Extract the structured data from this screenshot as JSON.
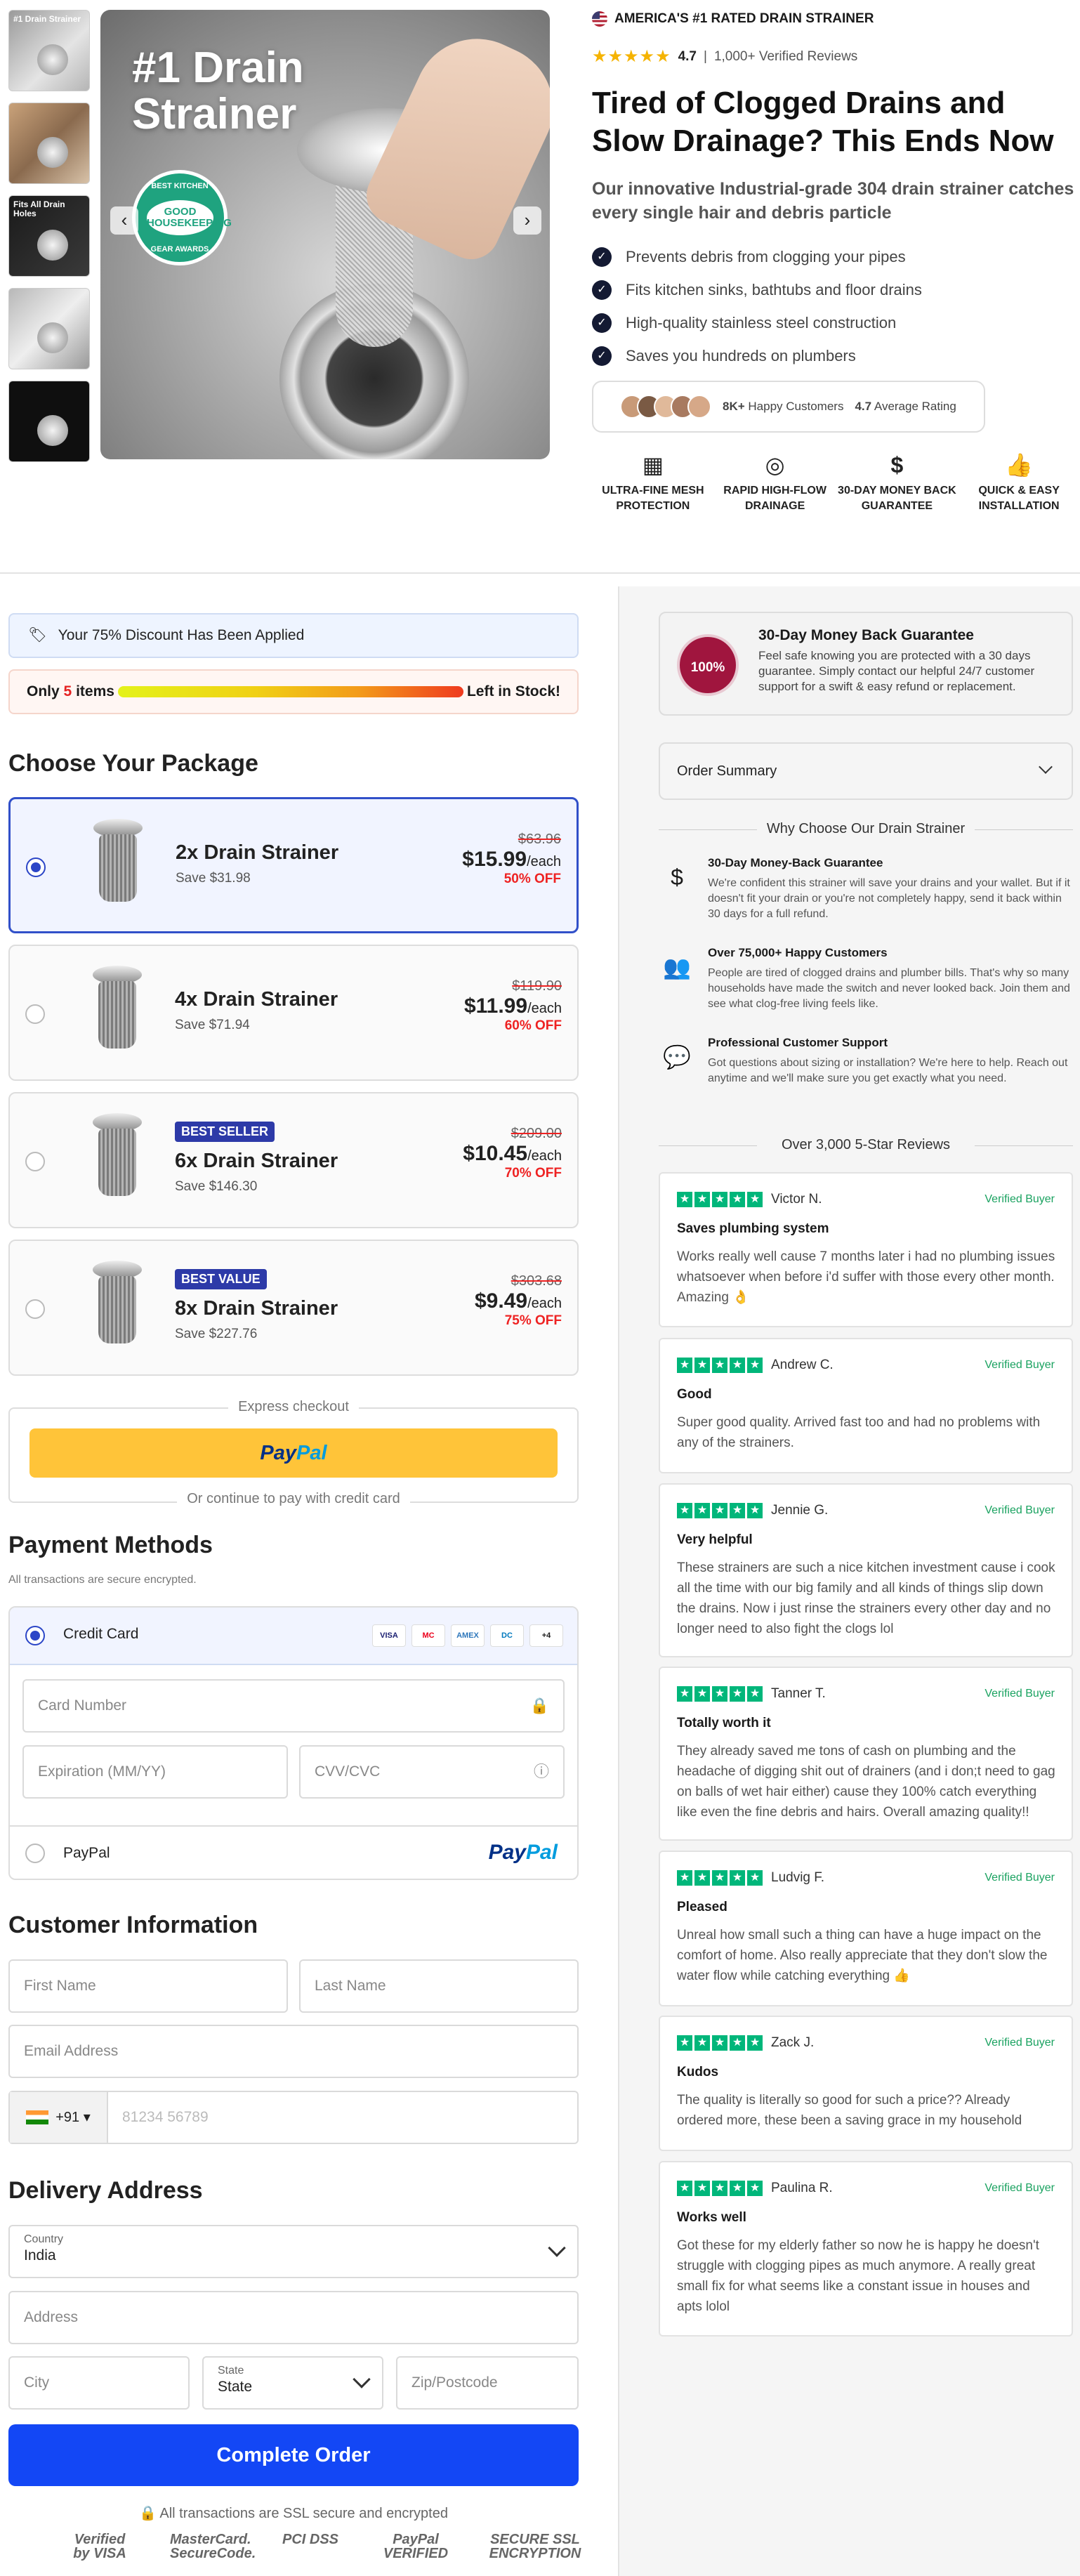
{
  "gallery": {
    "thumb1_text": "#1 Drain Strainer",
    "thumb3_text": "Fits All Drain Holes",
    "hero_title_line1": "#1 Drain",
    "hero_title_line2": "Strainer",
    "badge_top": "BEST KITCHEN",
    "badge_main": "GOOD HOUSEKEEPING",
    "badge_bottom": "GEAR AWARDS",
    "prev": "‹",
    "next": "›"
  },
  "product": {
    "rated": "AMERICA'S #1 RATED DRAIN STRAINER",
    "stars": "★★★★★",
    "rating": "4.7",
    "reviews": "1,000+ Verified Reviews",
    "headline": "Tired of Clogged Drains and Slow Drainage? This Ends Now",
    "subline": "Our innovative Industrial-grade 304 drain strainer catches every single hair and debris particle",
    "bullets": [
      "Prevents debris from clogging your pipes",
      "Fits kitchen sinks, bathtubs and floor drains",
      "High-quality stainless steel construction",
      "Saves you hundreds on plumbers"
    ],
    "happy_count": "8K+",
    "happy_label": "Happy Customers",
    "avg_value": "4.7",
    "avg_label": "Average Rating",
    "features": [
      {
        "icon": "▦",
        "label": "ULTRA-FINE MESH PROTECTION"
      },
      {
        "icon": "◎",
        "label": "RAPID HIGH-FLOW DRAINAGE"
      },
      {
        "icon": "$",
        "label": "30-DAY MONEY BACK GUARANTEE"
      },
      {
        "icon": "👍",
        "label": "QUICK & EASY INSTALLATION"
      }
    ]
  },
  "checkout": {
    "discount": "Your 75% Discount Has Been Applied",
    "stock_prefix": "Only",
    "stock_count": "5",
    "stock_suffix": "items",
    "stock_right": "Left in Stock!",
    "package_title": "Choose Your Package",
    "packages": [
      {
        "name": "2x Drain Strainer",
        "save": "Save $31.98",
        "old": "$63.96",
        "now": "$15.99",
        "each": "/each",
        "off": "50% OFF",
        "tag": ""
      },
      {
        "name": "4x Drain Strainer",
        "save": "Save $71.94",
        "old": "$119.90",
        "now": "$11.99",
        "each": "/each",
        "off": "60% OFF",
        "tag": ""
      },
      {
        "name": "6x Drain Strainer",
        "save": "Save $146.30",
        "old": "$209.00",
        "now": "$10.45",
        "each": "/each",
        "off": "70% OFF",
        "tag": "BEST SELLER"
      },
      {
        "name": "8x Drain Strainer",
        "save": "Save $227.76",
        "old": "$303.68",
        "now": "$9.49",
        "each": "/each",
        "off": "75% OFF",
        "tag": "BEST VALUE"
      }
    ],
    "express_label": "Express checkout",
    "paypal_a": "Pay",
    "paypal_b": "Pal",
    "or_continue": "Or continue to pay with credit card",
    "payment_title": "Payment Methods",
    "payment_note": "All transactions are secure encrypted.",
    "credit_card": "Credit Card",
    "card_brands": [
      "VISA",
      "MC",
      "AMEX",
      "DC",
      "+4"
    ],
    "card_number": "Card Number",
    "expiration": "Expiration (MM/YY)",
    "cvv": "CVV/CVC",
    "paypal_option": "PayPal",
    "customer_title": "Customer Information",
    "first_name": "First Name",
    "last_name": "Last Name",
    "email": "Email Address",
    "phone_code": "+91 ▾",
    "phone_placeholder": "81234 56789",
    "delivery_title": "Delivery Address",
    "country_label": "Country",
    "country_value": "India",
    "address": "Address",
    "city": "City",
    "state_label": "State",
    "state_value": "State",
    "zip": "Zip/Postcode",
    "order_button": "Complete Order",
    "ssl_note": "🔒 All transactions are SSL secure and encrypted",
    "trust": [
      "Verified by VISA",
      "MasterCard. SecureCode.",
      "PCI DSS",
      "PayPal VERIFIED",
      "SECURE SSL ENCRYPTION"
    ]
  },
  "sidebar": {
    "seal": "100%",
    "guarantee_title": "30-Day Money Back Guarantee",
    "guarantee_desc": "Feel safe knowing you are protected with a 30 days guarantee. Simply contact our helpful 24/7 customer support for a swift & easy refund or replacement.",
    "order_summary": "Order Summary",
    "why_title": "Why Choose Our Drain Strainer",
    "why": [
      {
        "icon": "$",
        "title": "30-Day Money-Back Guarantee",
        "desc": "We're confident this strainer will save your drains and your wallet. But if it doesn't fit your drain or you're not completely happy, send it back within 30 days for a full refund."
      },
      {
        "icon": "👥",
        "title": "Over 75,000+ Happy Customers",
        "desc": "People are tired of clogged drains and plumber bills. That's why so many households have made the switch and never looked back. Join them and see what clog-free living feels like."
      },
      {
        "icon": "💬",
        "title": "Professional Customer Support",
        "desc": "Got questions about sizing or installation? We're here to help. Reach out anytime and we'll make sure you get exactly what you need."
      }
    ],
    "reviews_title": "Over 3,000 5-Star Reviews",
    "verified_label": "Verified Buyer",
    "reviews": [
      {
        "name": "Victor N.",
        "title": "Saves plumbing system",
        "body": "Works really well cause 7 months later i had no plumbing issues whatsoever when before i'd suffer with those every other month. Amazing 👌"
      },
      {
        "name": "Andrew C.",
        "title": "Good",
        "body": "Super good quality. Arrived fast too and had no problems with any of the strainers."
      },
      {
        "name": "Jennie G.",
        "title": "Very helpful",
        "body": "These strainers are such a nice kitchen investment cause i cook all the time with our big family and all kinds of things slip down the drains. Now i just rinse the strainers every other day and no longer need to also fight the clogs lol"
      },
      {
        "name": "Tanner T.",
        "title": "Totally worth it",
        "body": "They already saved me tons of cash on plumbing and the headache of digging shit out of drainers (and i don;t need to gag on balls of wet hair either) cause they 100% catch everything like even the fine debris and hairs. Overall amazing quality!!"
      },
      {
        "name": "Ludvig F.",
        "title": "Pleased",
        "body": "Unreal how small such a thing can have a huge impact on the comfort of home. Also really appreciate that they don't slow the water flow while catching everything 👍"
      },
      {
        "name": "Zack J.",
        "title": "Kudos",
        "body": "The quality is literally so good for such a price?? Already ordered more, these been a saving grace in my household"
      },
      {
        "name": "Paulina R.",
        "title": "Works well",
        "body": "Got these for my elderly father so now he is happy he doesn't struggle with clogging pipes as much anymore. A really great small fix for what seems like a constant issue in houses and apts lolol"
      }
    ]
  }
}
